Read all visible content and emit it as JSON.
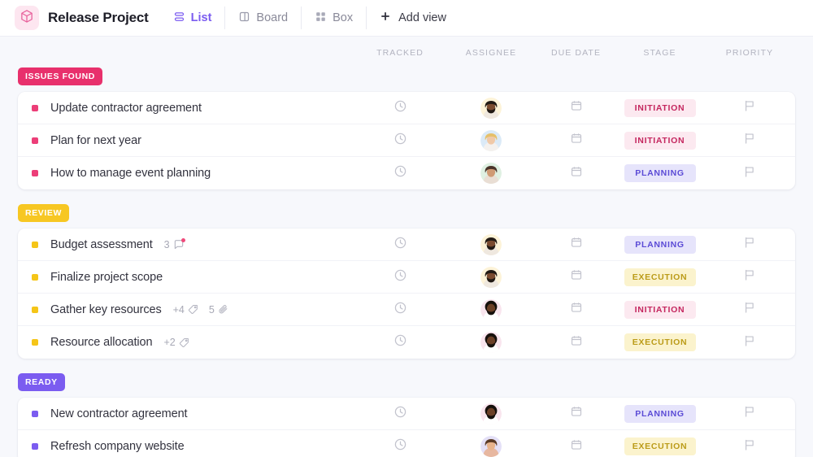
{
  "header": {
    "logo_icon": "cube-icon",
    "title": "Release Project",
    "tabs": [
      {
        "label": "List",
        "icon": "list-icon",
        "active": true
      },
      {
        "label": "Board",
        "icon": "board-icon",
        "active": false
      },
      {
        "label": "Box",
        "icon": "box-icon",
        "active": false
      }
    ],
    "add_view_label": "Add view",
    "add_view_icon": "plus-icon"
  },
  "columns": [
    {
      "key": "tracked",
      "label": "TRACKED"
    },
    {
      "key": "assignee",
      "label": "ASSIGNEE"
    },
    {
      "key": "due_date",
      "label": "DUE DATE"
    },
    {
      "key": "stage",
      "label": "STAGE"
    },
    {
      "key": "priority",
      "label": "PRIORITY"
    }
  ],
  "colors": {
    "badge_issues_found": "#e8306c",
    "badge_review": "#f7c723",
    "badge_ready": "#7b5cf0",
    "accent_purple": "#7b5cf0",
    "page_background": "#f7f8fc",
    "card_background": "#ffffff"
  },
  "icons": {
    "tracked": "timer-icon",
    "due_date": "calendar-icon",
    "priority": "flag-icon",
    "tag": "tag-icon",
    "attachment": "paperclip-icon",
    "comment": "comment-icon"
  },
  "groups": [
    {
      "name": "ISSUES FOUND",
      "color": "#e8306c",
      "dot_color": "#ec3e78",
      "rows": [
        {
          "title": "Update contractor agreement",
          "stage": "INITIATION",
          "stage_class": "pill-initiation",
          "avatar": "avatar-1",
          "meta": []
        },
        {
          "title": "Plan for next year",
          "stage": "INITIATION",
          "stage_class": "pill-initiation",
          "avatar": "avatar-2",
          "meta": []
        },
        {
          "title": "How to manage event planning",
          "stage": "PLANNING",
          "stage_class": "pill-planning",
          "avatar": "avatar-3",
          "meta": []
        }
      ]
    },
    {
      "name": "REVIEW",
      "color": "#f7c723",
      "dot_color": "#f5c518",
      "rows": [
        {
          "title": "Budget assessment",
          "stage": "PLANNING",
          "stage_class": "pill-planning",
          "avatar": "avatar-4",
          "meta": [
            {
              "icon": "comment-icon",
              "value": "3",
              "dot": true
            }
          ]
        },
        {
          "title": "Finalize project scope",
          "stage": "EXECUTION",
          "stage_class": "pill-execution",
          "avatar": "avatar-4",
          "meta": []
        },
        {
          "title": "Gather key resources",
          "stage": "INITIATION",
          "stage_class": "pill-initiation",
          "avatar": "avatar-5",
          "meta": [
            {
              "icon": "tag-icon",
              "value": "+4"
            },
            {
              "icon": "paperclip-icon",
              "value": "5"
            }
          ]
        },
        {
          "title": "Resource allocation",
          "stage": "EXECUTION",
          "stage_class": "pill-execution",
          "avatar": "avatar-5",
          "meta": [
            {
              "icon": "tag-icon",
              "value": "+2"
            }
          ]
        }
      ]
    },
    {
      "name": "READY",
      "color": "#7b5cf0",
      "dot_color": "#7b5cf0",
      "rows": [
        {
          "title": "New contractor agreement",
          "stage": "PLANNING",
          "stage_class": "pill-planning",
          "avatar": "avatar-5",
          "meta": []
        },
        {
          "title": "Refresh company website",
          "stage": "EXECUTION",
          "stage_class": "pill-execution",
          "avatar": "avatar-6",
          "meta": []
        }
      ]
    }
  ]
}
